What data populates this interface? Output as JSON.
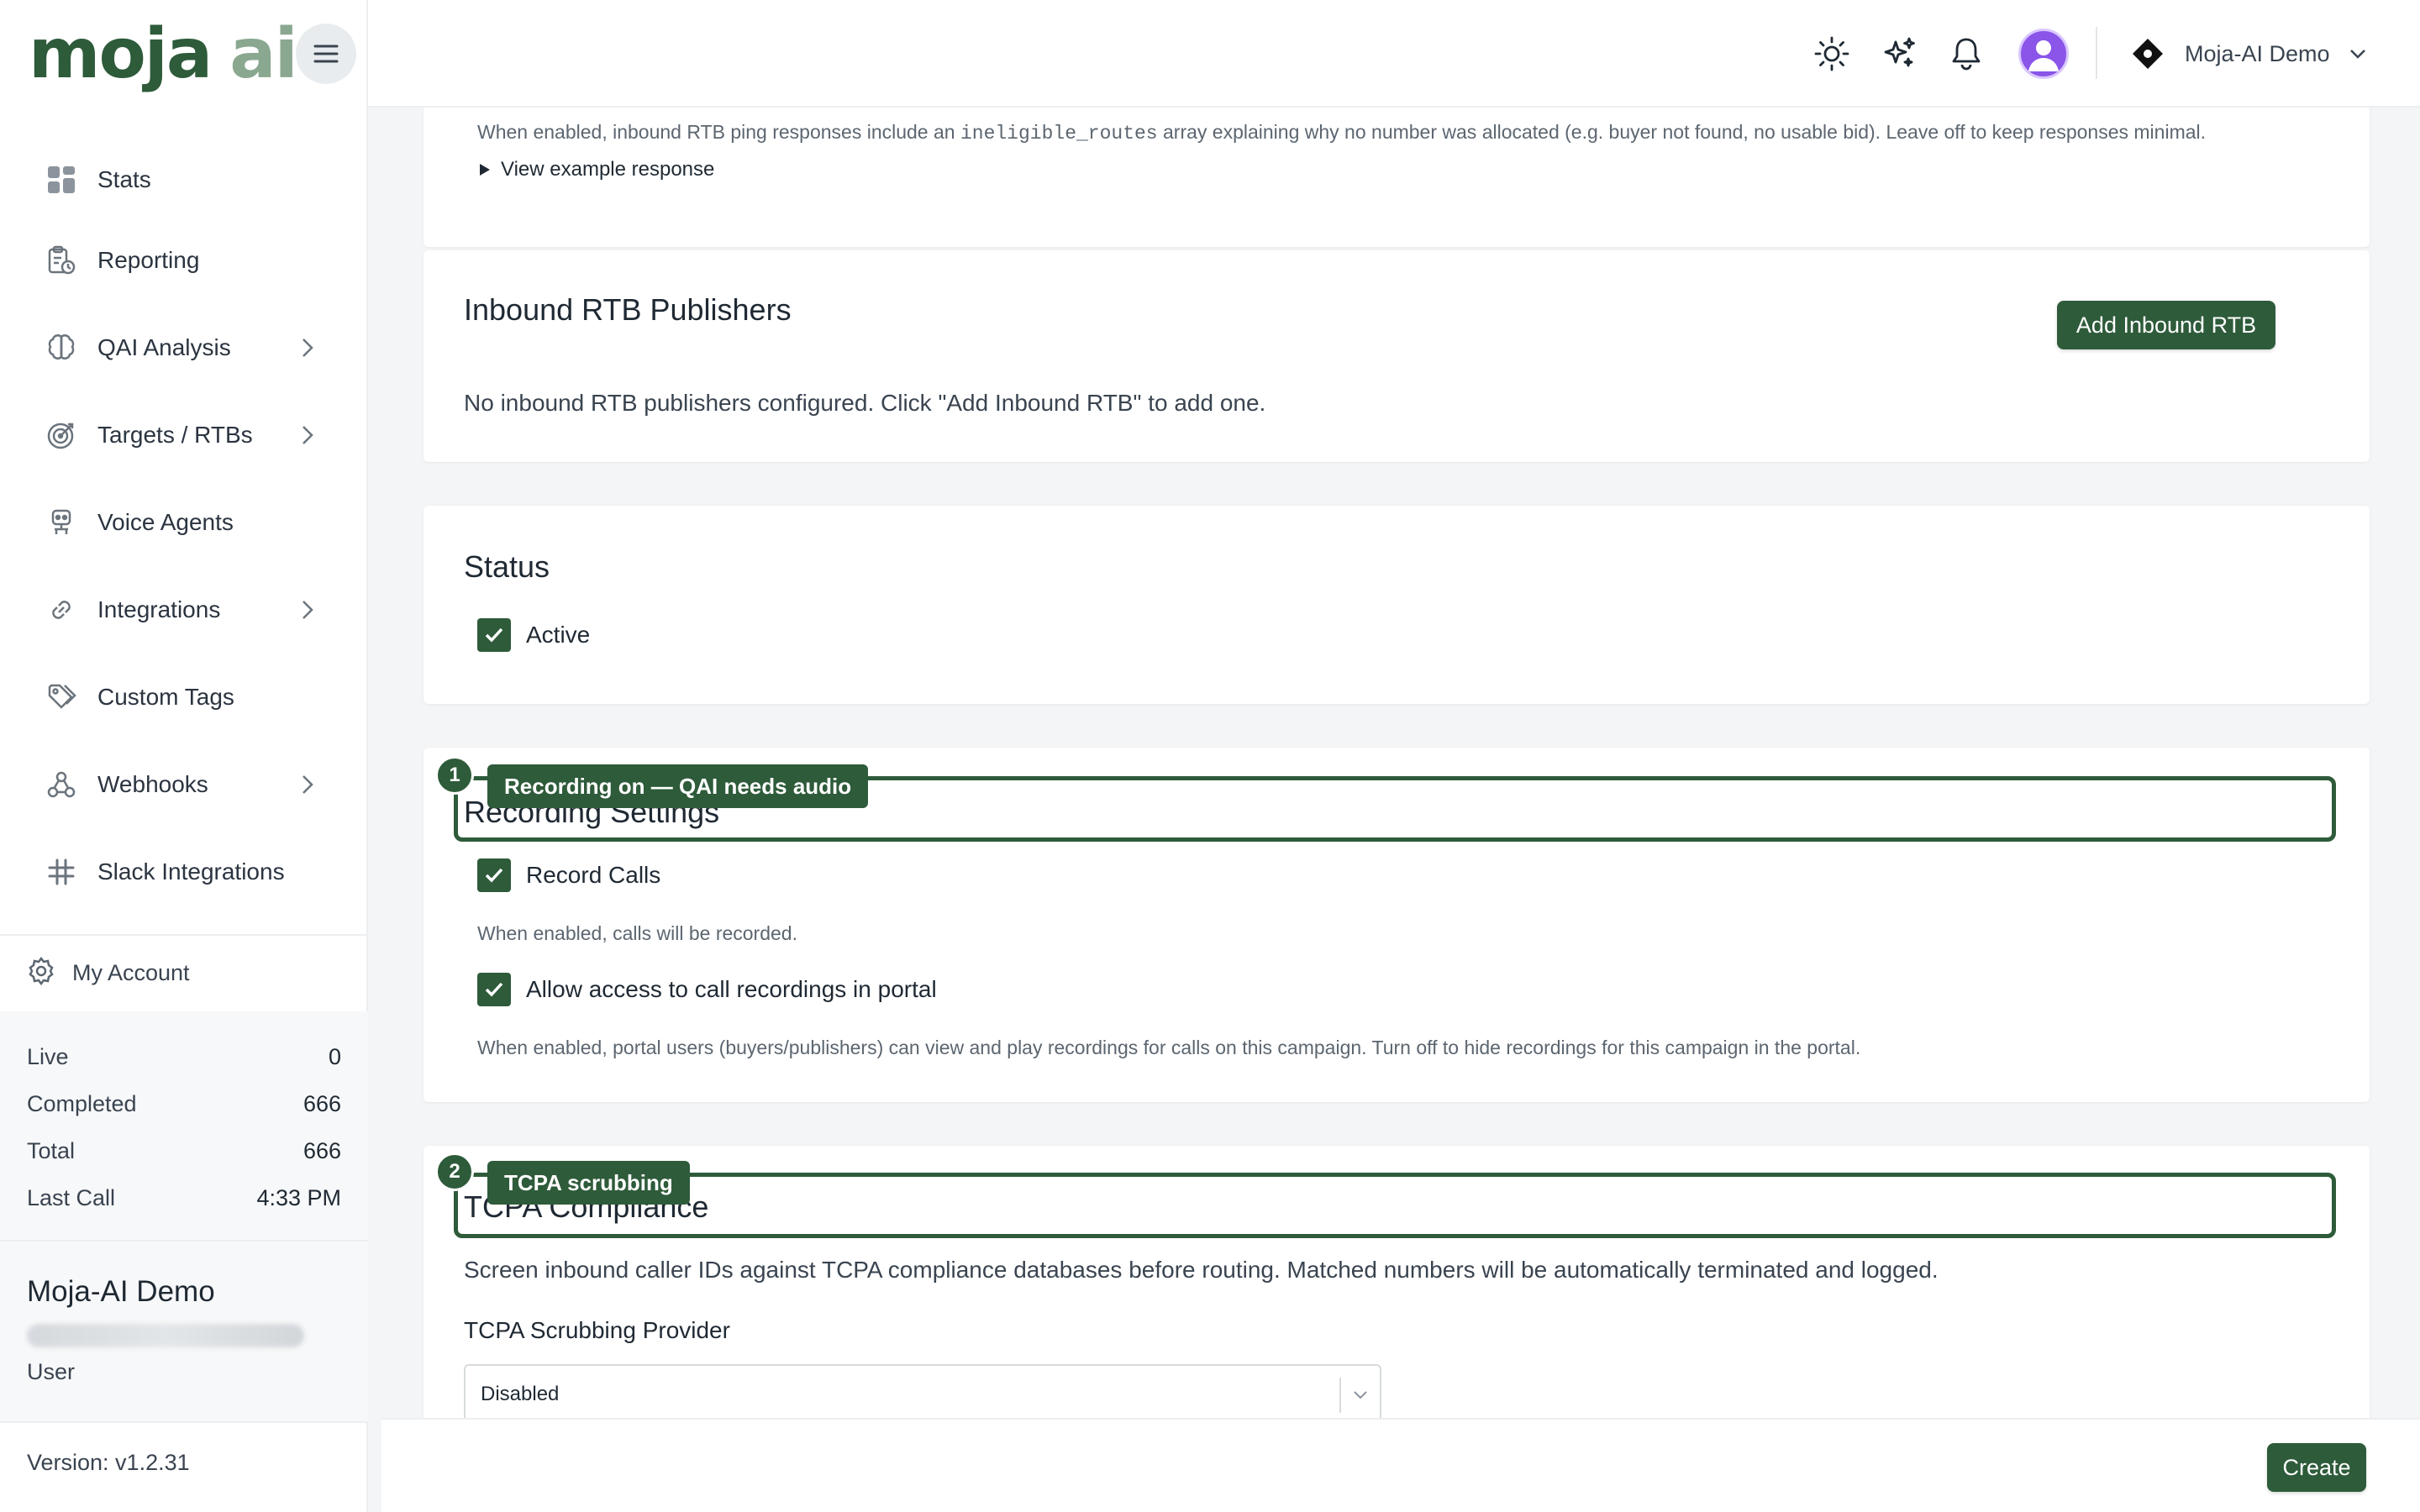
{
  "brand": {
    "part1": "moja",
    "part2": "ai"
  },
  "sidebar": {
    "items": [
      {
        "label": "Stats",
        "icon": "grid-icon",
        "has_chevron": false
      },
      {
        "label": "Reporting",
        "icon": "clipboard-clock-icon",
        "has_chevron": false
      },
      {
        "label": "QAI Analysis",
        "icon": "brain-icon",
        "has_chevron": true
      },
      {
        "label": "Targets / RTBs",
        "icon": "target-icon",
        "has_chevron": true
      },
      {
        "label": "Voice Agents",
        "icon": "robot-icon",
        "has_chevron": false
      },
      {
        "label": "Integrations",
        "icon": "link-icon",
        "has_chevron": true
      },
      {
        "label": "Custom Tags",
        "icon": "tags-icon",
        "has_chevron": false
      },
      {
        "label": "Webhooks",
        "icon": "webhook-icon",
        "has_chevron": true
      },
      {
        "label": "Slack Integrations",
        "icon": "slack-icon",
        "has_chevron": false
      }
    ],
    "account_label": "My Account",
    "stats": [
      {
        "label": "Live",
        "value": "0"
      },
      {
        "label": "Completed",
        "value": "666"
      },
      {
        "label": "Total",
        "value": "666"
      },
      {
        "label": "Last Call",
        "value": "4:33 PM"
      }
    ],
    "org_name": "Moja-AI Demo",
    "role": "User",
    "version": "Version: v1.2.31"
  },
  "topbar": {
    "org_name": "Moja-AI Demo"
  },
  "cards": {
    "top": {
      "helper_pre": "When enabled, inbound RTB ping responses include an",
      "helper_code": "ineligible_routes",
      "helper_post": "array explaining why no number was allocated (e.g. buyer not found, no usable bid). Leave off to keep responses minimal.",
      "example_link": "View example response"
    },
    "publishers": {
      "title": "Inbound RTB Publishers",
      "button": "Add Inbound RTB",
      "empty": "No inbound RTB publishers configured. Click \"Add Inbound RTB\" to add one."
    },
    "status": {
      "title": "Status",
      "active_label": "Active"
    },
    "recording": {
      "title": "Recording Settings",
      "record_label": "Record Calls",
      "record_help": "When enabled, calls will be recorded.",
      "portal_label": "Allow access to call recordings in portal",
      "portal_help": "When enabled, portal users (buyers/publishers) can view and play recordings for calls on this campaign. Turn off to hide recordings for this campaign in the portal."
    },
    "tcpa": {
      "title": "TCPA Compliance",
      "description": "Screen inbound caller IDs against TCPA compliance databases before routing. Matched numbers will be automatically terminated and logged.",
      "provider_label": "TCPA Scrubbing Provider",
      "provider_value": "Disabled"
    }
  },
  "annotations": [
    {
      "number": "1",
      "text": "Recording on — QAI needs audio"
    },
    {
      "number": "2",
      "text": "TCPA scrubbing"
    }
  ],
  "footer": {
    "create_label": "Create"
  },
  "colors": {
    "accent": "#2e5b3a",
    "accent_light": "#8aa88f",
    "avatar": "#8a55e8"
  }
}
